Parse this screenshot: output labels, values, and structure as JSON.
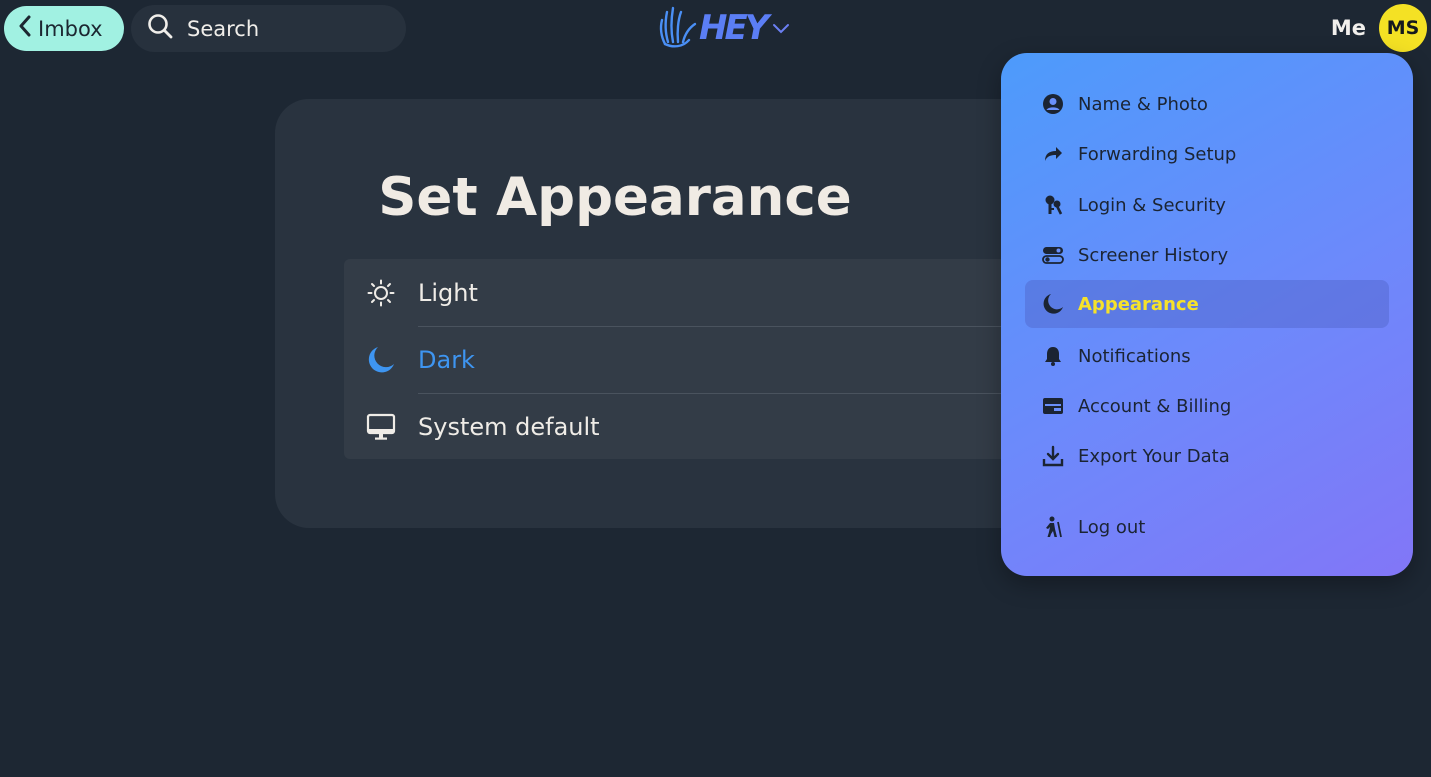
{
  "topbar": {
    "back_label": "Imbox",
    "search_label": "Search",
    "logo_text": "HEY",
    "me_label": "Me",
    "avatar_initials": "MS"
  },
  "appearance": {
    "title": "Set Appearance",
    "options": [
      {
        "label": "Light",
        "icon": "sun-icon",
        "selected": false
      },
      {
        "label": "Dark",
        "icon": "moon-icon",
        "selected": true
      },
      {
        "label": "System default",
        "icon": "monitor-icon",
        "selected": false
      }
    ]
  },
  "menu": {
    "items": [
      {
        "label": "Name & Photo",
        "icon": "user-circle-icon"
      },
      {
        "label": "Forwarding Setup",
        "icon": "forward-arrow-icon"
      },
      {
        "label": "Login & Security",
        "icon": "keys-icon"
      },
      {
        "label": "Screener History",
        "icon": "toggle-icon"
      },
      {
        "label": "Appearance",
        "icon": "moon-icon",
        "active": true
      },
      {
        "label": "Notifications",
        "icon": "bell-icon"
      },
      {
        "label": "Account & Billing",
        "icon": "wallet-icon"
      },
      {
        "label": "Export Your Data",
        "icon": "download-icon"
      },
      {
        "label": "Log out",
        "icon": "hiker-icon"
      }
    ]
  },
  "colors": {
    "background": "#1d2733",
    "card": "#29333f",
    "accent_blue": "#3e95f1",
    "active_menu_text": "#f6e22a",
    "back_button": "#a1f1e2",
    "avatar": "#f4e124"
  }
}
